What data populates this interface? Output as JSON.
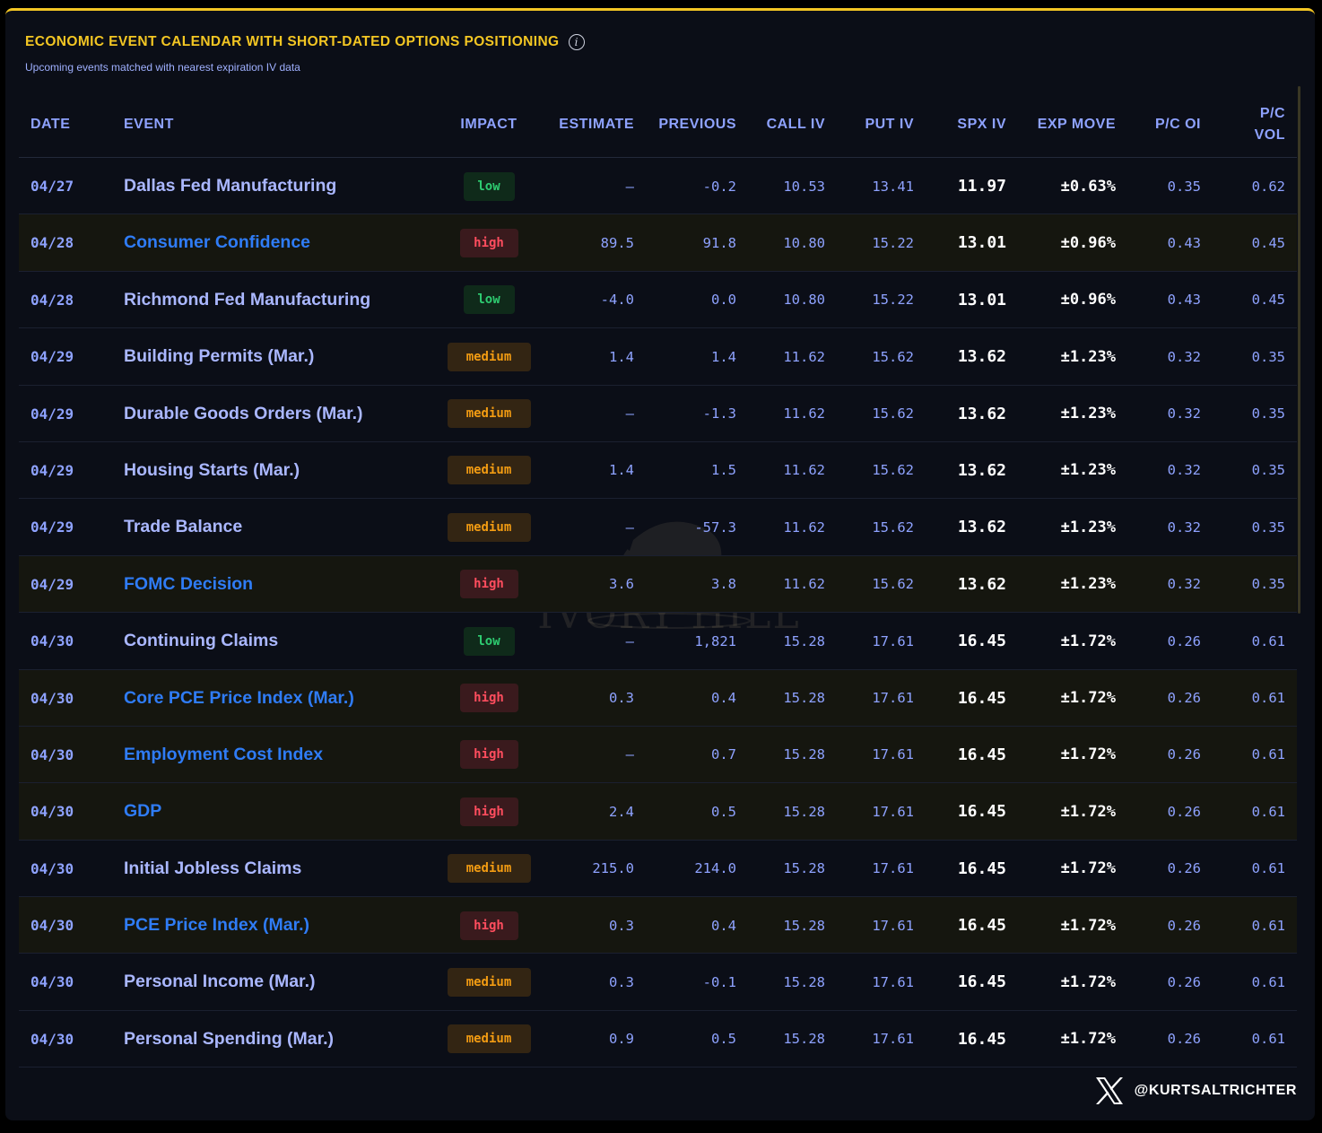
{
  "title": "ECONOMIC EVENT CALENDAR WITH SHORT-DATED OPTIONS POSITIONING",
  "subtitle": "Upcoming events matched with nearest expiration IV data",
  "info_icon": "info-icon",
  "watermark": "IVORY HILL",
  "footer": {
    "icon": "x-logo-icon",
    "handle": "@KURTSALTRICHTER"
  },
  "columns": {
    "date": "DATE",
    "event": "EVENT",
    "impact": "IMPACT",
    "estimate": "ESTIMATE",
    "previous": "PREVIOUS",
    "call_iv": "CALL IV",
    "put_iv": "PUT IV",
    "spx_iv": "SPX IV",
    "exp_move": "EXP MOVE",
    "pc_oi": "P/C OI",
    "pc_vol_line1": "P/C",
    "pc_vol_line2": "VOL"
  },
  "colors": {
    "accent": "#f3c623",
    "header_text": "#8ea2ff",
    "high_event": "#2f7cf6",
    "low_badge": "#2ecc71",
    "high_badge": "#ff4d5e",
    "medium_badge": "#f39c12"
  },
  "rows": [
    {
      "date": "04/27",
      "event": "Dallas Fed Manufacturing",
      "impact": "low",
      "estimate": "—",
      "previous": "-0.2",
      "call_iv": "10.53",
      "put_iv": "13.41",
      "spx_iv": "11.97",
      "exp_move": "±0.63%",
      "pc_oi": "0.35",
      "pc_vol": "0.62"
    },
    {
      "date": "04/28",
      "event": "Consumer Confidence",
      "impact": "high",
      "estimate": "89.5",
      "previous": "91.8",
      "call_iv": "10.80",
      "put_iv": "15.22",
      "spx_iv": "13.01",
      "exp_move": "±0.96%",
      "pc_oi": "0.43",
      "pc_vol": "0.45"
    },
    {
      "date": "04/28",
      "event": "Richmond Fed Manufacturing",
      "impact": "low",
      "estimate": "-4.0",
      "previous": "0.0",
      "call_iv": "10.80",
      "put_iv": "15.22",
      "spx_iv": "13.01",
      "exp_move": "±0.96%",
      "pc_oi": "0.43",
      "pc_vol": "0.45"
    },
    {
      "date": "04/29",
      "event": "Building Permits (Mar.)",
      "impact": "medium",
      "estimate": "1.4",
      "previous": "1.4",
      "call_iv": "11.62",
      "put_iv": "15.62",
      "spx_iv": "13.62",
      "exp_move": "±1.23%",
      "pc_oi": "0.32",
      "pc_vol": "0.35"
    },
    {
      "date": "04/29",
      "event": "Durable Goods Orders (Mar.)",
      "impact": "medium",
      "estimate": "—",
      "previous": "-1.3",
      "call_iv": "11.62",
      "put_iv": "15.62",
      "spx_iv": "13.62",
      "exp_move": "±1.23%",
      "pc_oi": "0.32",
      "pc_vol": "0.35"
    },
    {
      "date": "04/29",
      "event": "Housing Starts (Mar.)",
      "impact": "medium",
      "estimate": "1.4",
      "previous": "1.5",
      "call_iv": "11.62",
      "put_iv": "15.62",
      "spx_iv": "13.62",
      "exp_move": "±1.23%",
      "pc_oi": "0.32",
      "pc_vol": "0.35"
    },
    {
      "date": "04/29",
      "event": "Trade Balance",
      "impact": "medium",
      "estimate": "—",
      "previous": "-57.3",
      "call_iv": "11.62",
      "put_iv": "15.62",
      "spx_iv": "13.62",
      "exp_move": "±1.23%",
      "pc_oi": "0.32",
      "pc_vol": "0.35"
    },
    {
      "date": "04/29",
      "event": "FOMC Decision",
      "impact": "high",
      "estimate": "3.6",
      "previous": "3.8",
      "call_iv": "11.62",
      "put_iv": "15.62",
      "spx_iv": "13.62",
      "exp_move": "±1.23%",
      "pc_oi": "0.32",
      "pc_vol": "0.35"
    },
    {
      "date": "04/30",
      "event": "Continuing Claims",
      "impact": "low",
      "estimate": "—",
      "previous": "1,821",
      "call_iv": "15.28",
      "put_iv": "17.61",
      "spx_iv": "16.45",
      "exp_move": "±1.72%",
      "pc_oi": "0.26",
      "pc_vol": "0.61"
    },
    {
      "date": "04/30",
      "event": "Core PCE Price Index (Mar.)",
      "impact": "high",
      "estimate": "0.3",
      "previous": "0.4",
      "call_iv": "15.28",
      "put_iv": "17.61",
      "spx_iv": "16.45",
      "exp_move": "±1.72%",
      "pc_oi": "0.26",
      "pc_vol": "0.61"
    },
    {
      "date": "04/30",
      "event": "Employment Cost Index",
      "impact": "high",
      "estimate": "—",
      "previous": "0.7",
      "call_iv": "15.28",
      "put_iv": "17.61",
      "spx_iv": "16.45",
      "exp_move": "±1.72%",
      "pc_oi": "0.26",
      "pc_vol": "0.61"
    },
    {
      "date": "04/30",
      "event": "GDP",
      "impact": "high",
      "estimate": "2.4",
      "previous": "0.5",
      "call_iv": "15.28",
      "put_iv": "17.61",
      "spx_iv": "16.45",
      "exp_move": "±1.72%",
      "pc_oi": "0.26",
      "pc_vol": "0.61"
    },
    {
      "date": "04/30",
      "event": "Initial Jobless Claims",
      "impact": "medium",
      "estimate": "215.0",
      "previous": "214.0",
      "call_iv": "15.28",
      "put_iv": "17.61",
      "spx_iv": "16.45",
      "exp_move": "±1.72%",
      "pc_oi": "0.26",
      "pc_vol": "0.61"
    },
    {
      "date": "04/30",
      "event": "PCE Price Index (Mar.)",
      "impact": "high",
      "estimate": "0.3",
      "previous": "0.4",
      "call_iv": "15.28",
      "put_iv": "17.61",
      "spx_iv": "16.45",
      "exp_move": "±1.72%",
      "pc_oi": "0.26",
      "pc_vol": "0.61"
    },
    {
      "date": "04/30",
      "event": "Personal Income (Mar.)",
      "impact": "medium",
      "estimate": "0.3",
      "previous": "-0.1",
      "call_iv": "15.28",
      "put_iv": "17.61",
      "spx_iv": "16.45",
      "exp_move": "±1.72%",
      "pc_oi": "0.26",
      "pc_vol": "0.61"
    },
    {
      "date": "04/30",
      "event": "Personal Spending (Mar.)",
      "impact": "medium",
      "estimate": "0.9",
      "previous": "0.5",
      "call_iv": "15.28",
      "put_iv": "17.61",
      "spx_iv": "16.45",
      "exp_move": "±1.72%",
      "pc_oi": "0.26",
      "pc_vol": "0.61"
    }
  ]
}
